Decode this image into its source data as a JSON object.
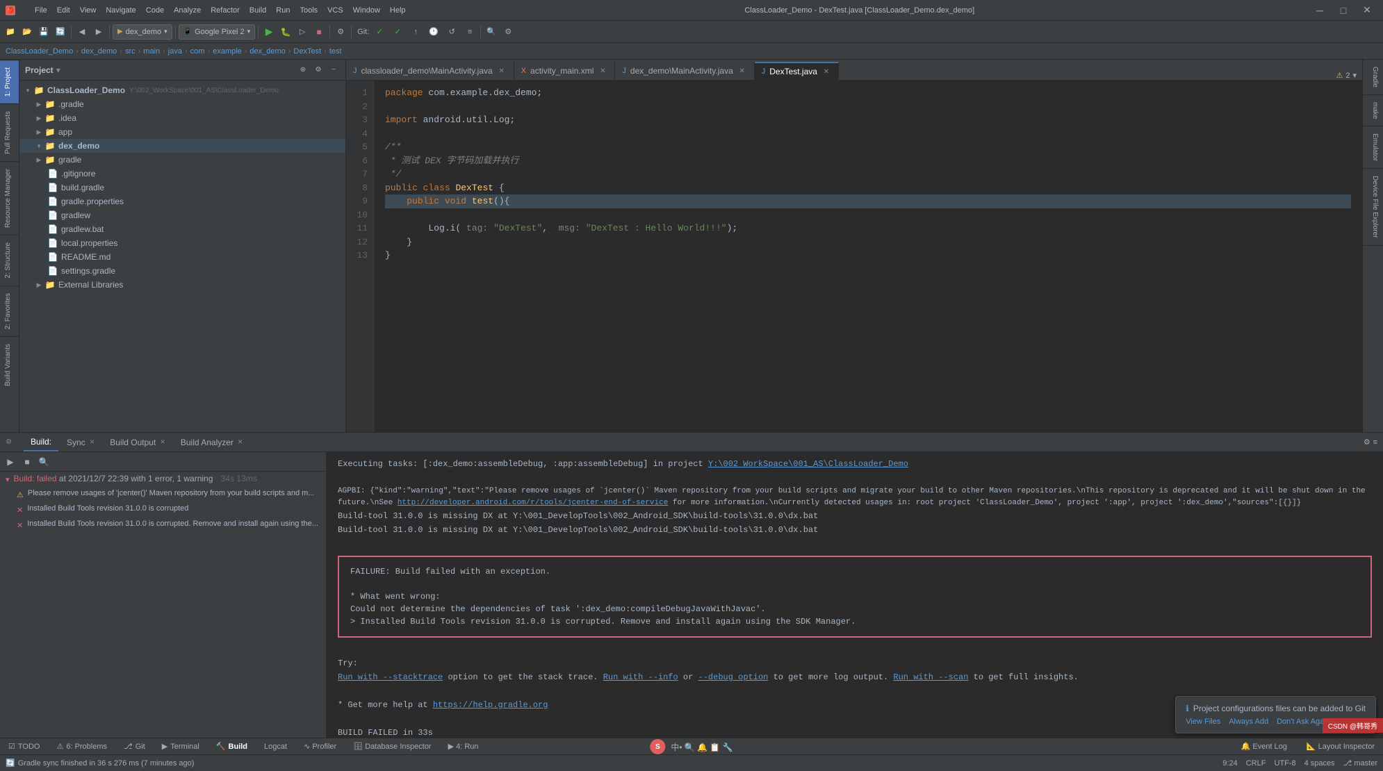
{
  "titleBar": {
    "title": "ClassLoader_Demo - DexTest.java [ClassLoader_Demo.dex_demo]",
    "closeBtn": "✕",
    "maxBtn": "□",
    "minBtn": "─"
  },
  "menuBar": {
    "items": [
      "File",
      "Edit",
      "View",
      "Navigate",
      "Code",
      "Analyze",
      "Refactor",
      "Build",
      "Run",
      "Tools",
      "VCS",
      "Window",
      "Help"
    ]
  },
  "toolbar": {
    "projectName": "dex_demo",
    "deviceName": "Google Pixel 2"
  },
  "breadcrumb": {
    "parts": [
      "ClassLoader_Demo",
      "dex_demo",
      "src",
      "main",
      "java",
      "com",
      "example",
      "dex_demo",
      "DexTest",
      "test"
    ]
  },
  "projectPanel": {
    "title": "Project",
    "rootItem": "ClassLoader_Demo",
    "rootPath": "Y:\\002_WorkSpace\\001_AS\\ClassLoader_Demo",
    "items": [
      {
        "name": ".gradle",
        "type": "folder",
        "level": 1,
        "collapsed": true
      },
      {
        "name": ".idea",
        "type": "folder",
        "level": 1,
        "collapsed": true
      },
      {
        "name": "app",
        "type": "folder",
        "level": 1,
        "collapsed": true
      },
      {
        "name": "dex_demo",
        "type": "folder",
        "level": 1,
        "collapsed": false,
        "highlighted": true
      },
      {
        "name": "gradle",
        "type": "folder",
        "level": 1,
        "collapsed": true
      },
      {
        "name": ".gitignore",
        "type": "file",
        "level": 1
      },
      {
        "name": "build.gradle",
        "type": "gradle",
        "level": 1
      },
      {
        "name": "gradle.properties",
        "type": "file",
        "level": 1
      },
      {
        "name": "gradlew",
        "type": "file",
        "level": 1
      },
      {
        "name": "gradlew.bat",
        "type": "file",
        "level": 1
      },
      {
        "name": "local.properties",
        "type": "file-prop",
        "level": 1
      },
      {
        "name": "README.md",
        "type": "file",
        "level": 1
      },
      {
        "name": "settings.gradle",
        "type": "gradle",
        "level": 1
      },
      {
        "name": "External Libraries",
        "type": "folder",
        "level": 1,
        "collapsed": true
      }
    ]
  },
  "editorTabs": [
    {
      "name": "classloader_demo\\MainActivity.java",
      "icon": "J",
      "active": false,
      "closeable": true
    },
    {
      "name": "activity_main.xml",
      "icon": "X",
      "active": false,
      "closeable": true
    },
    {
      "name": "dex_demo\\MainActivity.java",
      "icon": "J",
      "active": false,
      "closeable": true
    },
    {
      "name": "DexTest.java",
      "icon": "J",
      "active": true,
      "closeable": true
    }
  ],
  "codeLines": [
    {
      "num": 1,
      "content": "package com.example.dex_demo;"
    },
    {
      "num": 2,
      "content": ""
    },
    {
      "num": 3,
      "content": "import android.util.Log;"
    },
    {
      "num": 4,
      "content": ""
    },
    {
      "num": 5,
      "content": "/**"
    },
    {
      "num": 6,
      "content": " * 测试 DEX 字节码加载并执行"
    },
    {
      "num": 7,
      "content": " */"
    },
    {
      "num": 8,
      "content": "public class DexTest {"
    },
    {
      "num": 9,
      "content": "    public void test(){",
      "highlight": true
    },
    {
      "num": 10,
      "content": "        Log.i( tag: \"DexTest\",  msg: \"DexTest : Hello World!!!\");"
    },
    {
      "num": 11,
      "content": "    }"
    },
    {
      "num": 12,
      "content": "}"
    },
    {
      "num": 13,
      "content": ""
    }
  ],
  "bottomPanel": {
    "tabs": [
      {
        "name": "Build",
        "active": true,
        "closeable": false
      },
      {
        "name": "Sync",
        "active": false,
        "closeable": true
      },
      {
        "name": "Build Output",
        "active": false,
        "closeable": true
      },
      {
        "name": "Build Analyzer",
        "active": false,
        "closeable": true
      }
    ],
    "buildStatus": {
      "label": "Build: failed",
      "detail": "at 2021/12/7 22:39 with 1 error, 1 warning",
      "time": "34s 13ms"
    },
    "buildItems": [
      {
        "text": "Please remove usages of 'jcenter()' Maven repository from your build scripts and m...",
        "type": "warning"
      },
      {
        "text": "Installed Build Tools revision 31.0.0 is corrupted",
        "type": "error"
      },
      {
        "text": "Installed Build Tools revision 31.0.0 is corrupted. Remove and install again using the...",
        "type": "error"
      }
    ],
    "outputLines": [
      "Executing tasks: [:dex_demo:assembleDebug, :app:assembleDebug] in project Y:\\002 WorkSpace\\001_AS\\ClassLoader_Demo",
      "",
      "AGPBI: {\"kind\":\"warning\",\"text\":\"Please remove usages of 'jcenter()' Maven repository from your build scripts and migrate your build to other Maven repositories.\\nThis repository is deprecated and it will be shut down in the future.\\nSee https://developer.android.com/r/tools/jcenter-end-of-service for more information.\\nCurrently detected usages in: root project 'ClassLoader_Demo', project ':app', project ':dex_demo',\"sources\":[{}]}",
      "Build-tool 31.0.0 is missing DX at Y:\\001_DevelopTools\\002_Android_SDK\\build-tools\\31.0.0\\dx.bat",
      "Build-tool 31.0.0 is missing DX at Y:\\001_DevelopTools\\002_Android_SDK\\build-tools\\31.0.0\\dx.bat",
      ""
    ],
    "errorBox": {
      "line1": "FAILURE: Build failed with an exception.",
      "line2": "",
      "line3": "* What went wrong:",
      "line4": "Could not determine the dependencies of task ':dex_demo:compileDebugJavaWithJavac'.",
      "line5": "> Installed Build Tools revision 31.0.0 is corrupted. Remove and install again using the SDK Manager."
    },
    "tryLine": "Try:",
    "runLinks": {
      "stacktrace": "Run with --stacktrace",
      "info": "Run with --info",
      "debugOption": "--debug option",
      "scan": "Run with --scan"
    },
    "helpLine": "* Get more help at",
    "helpUrl": "https://help.gradle.org",
    "buildFailed": "BUILD FAILED in 33s"
  },
  "bottomToolTabs": [
    {
      "name": "TODO",
      "icon": "☑"
    },
    {
      "name": "Problems",
      "icon": "⚠",
      "badge": "6"
    },
    {
      "name": "Git",
      "icon": "⎇"
    },
    {
      "name": "Terminal",
      "icon": "▶"
    },
    {
      "name": "Build",
      "icon": "🔨",
      "active": true
    },
    {
      "name": "Logcat",
      "icon": "📋"
    },
    {
      "name": "Profiler",
      "icon": "📊"
    },
    {
      "name": "Database Inspector",
      "icon": "🗄"
    },
    {
      "name": "Run",
      "icon": "▶",
      "prefix": "4:"
    }
  ],
  "rightTools": [
    {
      "name": "Event Log",
      "icon": "🔔"
    },
    {
      "name": "Layout Inspector",
      "icon": "📐"
    }
  ],
  "statusBar": {
    "syncMsg": "Gradle sync finished in 36 s 276 ms (7 minutes ago)",
    "time": "9:24",
    "encoding": "CRLF",
    "charset": "UTF-8",
    "spaces": "4 spaces",
    "branch": "master"
  },
  "notification": {
    "icon": "ℹ",
    "text": "Project configurations files can be added to Git",
    "links": [
      "View Files",
      "Always Add",
      "Don't Ask Again"
    ]
  },
  "sidebarTabs": {
    "left": [
      "1: Project",
      "2: Pull Requests",
      "Resource Manager",
      "2: Structure",
      "2: Favorites",
      "Build Variants"
    ],
    "right": [
      "Gradle",
      "make",
      "Emulator",
      "Device File Explorer"
    ]
  }
}
